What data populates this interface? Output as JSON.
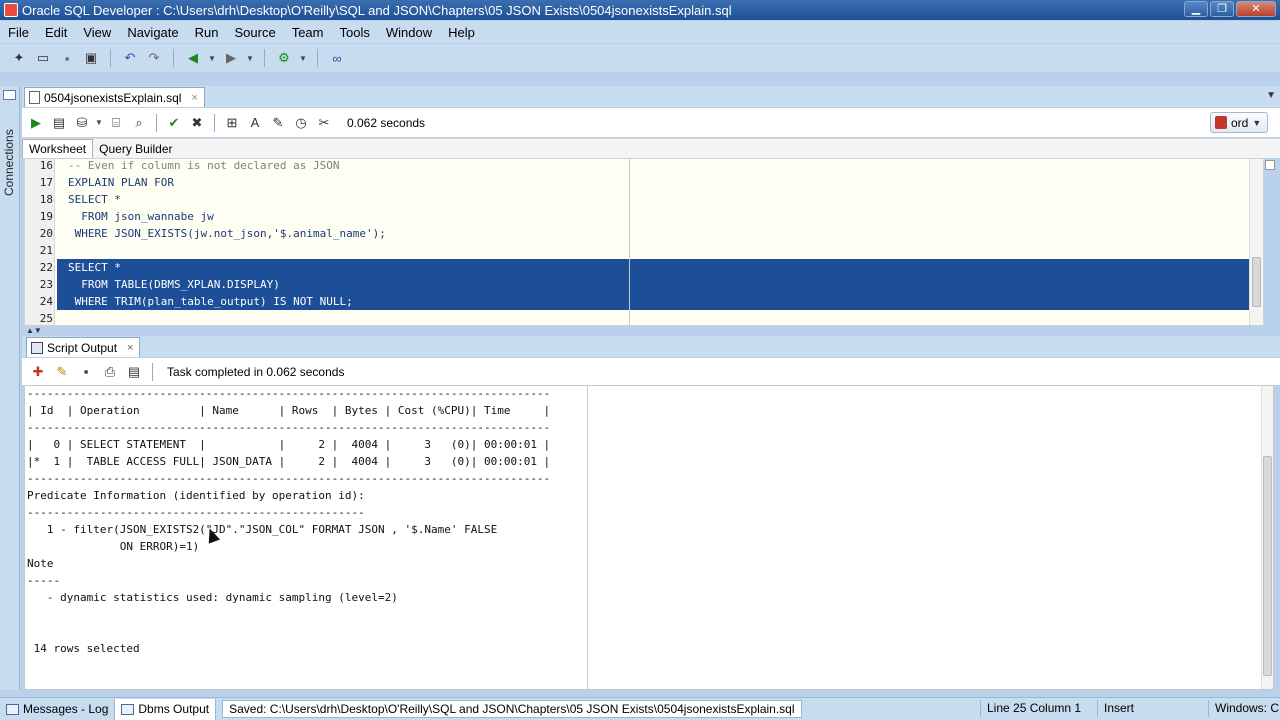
{
  "window": {
    "title": "Oracle SQL Developer : C:\\Users\\drh\\Desktop\\O'Reilly\\SQL and JSON\\Chapters\\05 JSON Exists\\0504jsonexistsExplain.sql",
    "minimize": "▁",
    "maximize": "❐",
    "close": "✕"
  },
  "menu": [
    "File",
    "Edit",
    "View",
    "Navigate",
    "Run",
    "Source",
    "Team",
    "Tools",
    "Window",
    "Help"
  ],
  "left_panel": {
    "label": "Connections"
  },
  "editor_tab": {
    "label": "0504jsonexistsExplain.sql",
    "close": "×"
  },
  "editor_toolbar": {
    "exec_time": "0.062 seconds",
    "connection": "ord"
  },
  "worksheet_tabs": [
    "Worksheet",
    "Query Builder"
  ],
  "code_lines": [
    {
      "num": "16",
      "text": "-- Even if column is not declared as JSON",
      "kind": "comment"
    },
    {
      "num": "17",
      "text": "EXPLAIN PLAN FOR",
      "kind": "normal"
    },
    {
      "num": "18",
      "text": "SELECT *",
      "kind": "normal"
    },
    {
      "num": "19",
      "text": "  FROM json_wannabe jw",
      "kind": "normal"
    },
    {
      "num": "20",
      "text": " WHERE JSON_EXISTS(jw.not_json,'$.animal_name');",
      "kind": "normal"
    },
    {
      "num": "21",
      "text": "",
      "kind": "normal"
    },
    {
      "num": "22",
      "text": "SELECT *",
      "kind": "selected"
    },
    {
      "num": "23",
      "text": "  FROM TABLE(DBMS_XPLAN.DISPLAY)",
      "kind": "selected"
    },
    {
      "num": "24",
      "text": " WHERE TRIM(plan_table_output) IS NOT NULL;",
      "kind": "selected"
    },
    {
      "num": "25",
      "text": "",
      "kind": "normal"
    }
  ],
  "output_panel": {
    "tab_label": "Script Output",
    "close": "×",
    "task_message": "Task completed in 0.062 seconds",
    "lines": [
      "-------------------------------------------------------------------------------",
      "| Id  | Operation         | Name      | Rows  | Bytes | Cost (%CPU)| Time     |",
      "-------------------------------------------------------------------------------",
      "|   0 | SELECT STATEMENT  |           |     2 |  4004 |     3   (0)| 00:00:01 |",
      "|*  1 |  TABLE ACCESS FULL| JSON_DATA |     2 |  4004 |     3   (0)| 00:00:01 |",
      "-------------------------------------------------------------------------------",
      "Predicate Information (identified by operation id):",
      "---------------------------------------------------",
      "   1 - filter(JSON_EXISTS2(\"JD\".\"JSON_COL\" FORMAT JSON , '$.Name' FALSE",
      "              ON ERROR)=1)",
      "Note",
      "-----",
      "   - dynamic statistics used: dynamic sampling (level=2)",
      "",
      "",
      " 14 rows selected"
    ]
  },
  "status_bar": {
    "messages_tab": "Messages - Log",
    "dbms_tab": "Dbms Output",
    "saved_message": "Saved: C:\\Users\\drh\\Desktop\\O'Reilly\\SQL and JSON\\Chapters\\05 JSON Exists\\0504jsonexistsExplain.sql",
    "position": "Line 25 Column 1",
    "mode": "Insert",
    "platform": "Windows: CI"
  }
}
